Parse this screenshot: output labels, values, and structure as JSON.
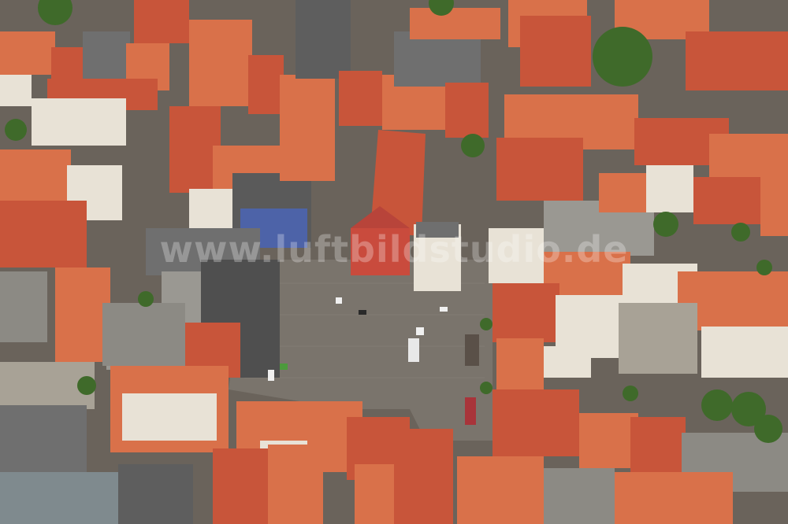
{
  "photo": {
    "subject": "aerial view of a historic town centre with a large market square and a red-roofed town hall",
    "watermark": "www.luftbildstudio.de",
    "palette": {
      "roof_red": "#c8553a",
      "roof_orange": "#d9714a",
      "roof_grey": "#6f6f6f",
      "square_paving": "#7a746c",
      "street": "#6a635b",
      "tree_green": "#3f6a2a",
      "building_white": "#e8e2d6",
      "town_hall_facade": "#c94b3d"
    }
  }
}
